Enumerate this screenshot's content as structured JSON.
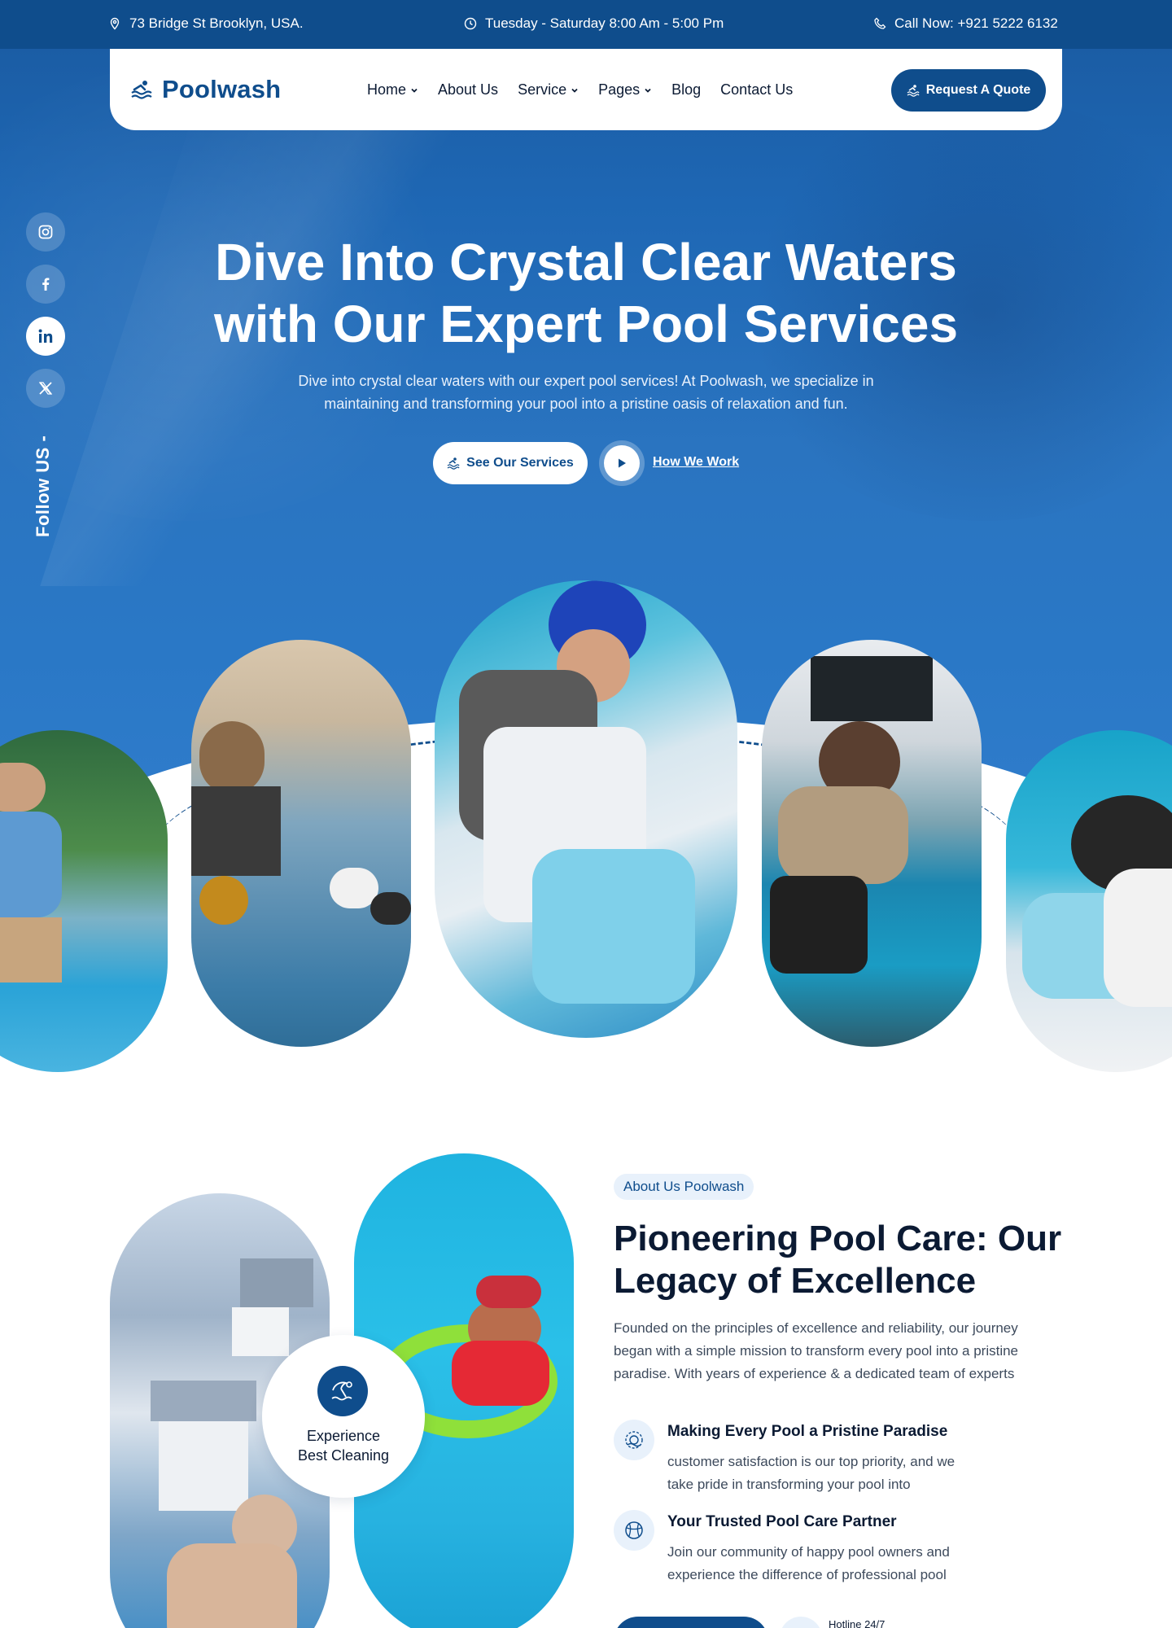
{
  "topbar": {
    "address": "73 Bridge St Brooklyn, USA.",
    "hours": "Tuesday - Saturday 8:00 Am - 5:00 Pm",
    "phone": "Call Now: +921 5222 6132"
  },
  "header": {
    "logo_text": "Poolwash",
    "nav": [
      "Home",
      "About Us",
      "Service",
      "Pages",
      "Blog",
      "Contact Us"
    ],
    "quote_button": "Request A Quote"
  },
  "social": {
    "icons": [
      "instagram-icon",
      "facebook-icon",
      "linkedin-icon",
      "x-icon"
    ],
    "follow_label": "Follow US -"
  },
  "hero": {
    "title_line1": "Dive Into Crystal Clear Waters",
    "title_line2": "with Our Expert Pool Services",
    "subtitle_line1": "Dive into crystal clear waters with our expert pool services! At Poolwash, we specialize in",
    "subtitle_line2": "maintaining and transforming your pool into a pristine oasis of relaxation and fun.",
    "primary_button": "See Our Services",
    "secondary_link": "How We Work"
  },
  "about": {
    "tag": "About Us Poolwash",
    "title_line1": "Pioneering Pool Care: Our",
    "title_line2": "Legacy of Excellence",
    "description_line1": "Founded on the principles of excellence and reliability, our journey",
    "description_line2": "began with a simple mission to transform every pool into a pristine",
    "description_line3": "paradise. With years of experience & a dedicated team of experts",
    "badge_line1": "Experience",
    "badge_line2": "Best Cleaning",
    "features": [
      {
        "title": "Making Every Pool a Pristine Paradise",
        "desc_line1": "customer satisfaction is our top priority, and we",
        "desc_line2": "take pride in transforming your pool into"
      },
      {
        "title": "Your Trusted Pool Care Partner",
        "desc_line1": "Join our community of happy pool owners and",
        "desc_line2": "experience the difference of professional pool"
      }
    ],
    "hotline_label": "Hotline 24/7"
  },
  "colors": {
    "brand": "#0f4d8c",
    "hero_blue": "#1e67b4",
    "accent_light": "#e8f1fb"
  }
}
